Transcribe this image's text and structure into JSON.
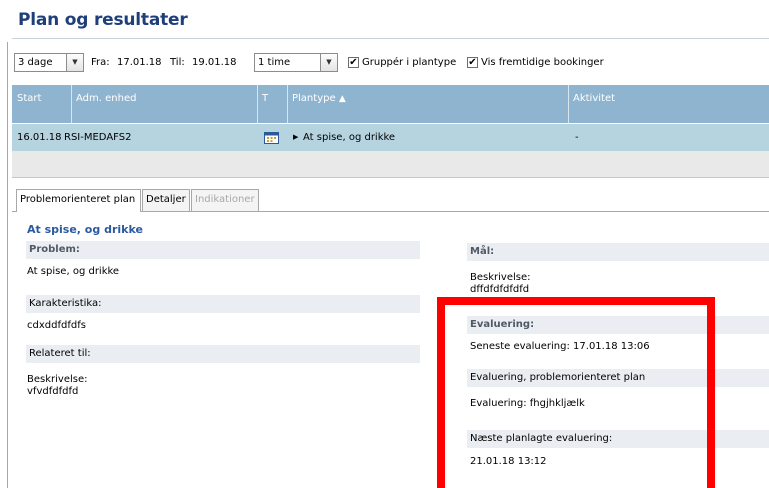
{
  "page": {
    "title": "Plan og resultater"
  },
  "toolbar": {
    "period_value": "3 dage",
    "from_label": "Fra:",
    "from_value": "17.01.18",
    "to_label": "Til:",
    "to_value": "19.01.18",
    "interval_value": "1 time",
    "group_label": "Gruppér i plantype",
    "group_checked": "✔",
    "future_label": "Vis fremtidige bookinger",
    "future_checked": "✔"
  },
  "grid": {
    "columns": [
      "Start",
      "Adm. enhed",
      "T",
      "Plantype",
      "Aktivitet"
    ],
    "sort_indicator": "▲",
    "rows": [
      {
        "start": "16.01.18",
        "unit": "RSI-MEDAFS2",
        "type_icon": "calendar-icon",
        "plantype": "At spise, og drikke",
        "activity": "-"
      }
    ]
  },
  "tabs": [
    "Problemorienteret plan",
    "Detaljer",
    "Indikationer"
  ],
  "detail": {
    "heading": "At spise, og drikke",
    "problem_label": "Problem:",
    "problem_value": "At spise, og drikke",
    "karakteristika_label": "Karakteristika:",
    "karakteristika_value": "cdxddfdfdfs",
    "relateret_label": "Relateret til:",
    "relateret_desc_label": "Beskrivelse:",
    "relateret_desc_value": "vfvdfdfdfd",
    "maal_label": "Mål:",
    "maal_desc_label": "Beskrivelse:",
    "maal_desc_value": "dffdfdfdfdfd",
    "evaluering_label": "Evaluering:",
    "seneste_evaluering": "Seneste evaluering: 17.01.18 13:06",
    "evaluering_plan_label": "Evaluering, problemorienteret plan",
    "evaluering_text": "Evaluering: fhgjhkljælk",
    "naeste_label": "Næste planlagte evaluering:",
    "naeste_value": "21.01.18 13:12"
  },
  "colors": {
    "title": "#1f3f7a",
    "grid_header": "#8fb4d0",
    "grid_row_selected": "#b6d4e0",
    "annotation_box": "#ff0000"
  }
}
